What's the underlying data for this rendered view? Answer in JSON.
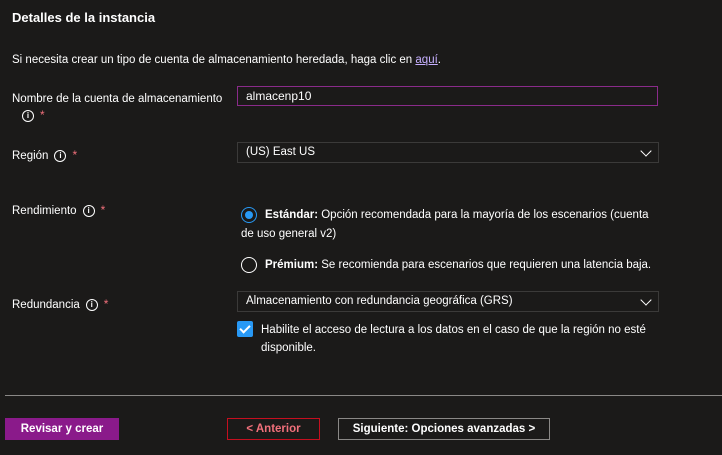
{
  "section": {
    "title": "Detalles de la instancia"
  },
  "intro": {
    "text": "Si necesita crear un tipo de cuenta de almacenamiento heredada, haga clic en ",
    "link": "aquí",
    "suffix": "."
  },
  "fields": {
    "account_name": {
      "label": "Nombre de la cuenta de almacenamiento",
      "value": "almacenp10",
      "required": "*"
    },
    "region": {
      "label": "Región",
      "value": "(US) East US",
      "required": "*"
    },
    "performance": {
      "label": "Rendimiento",
      "required": "*",
      "options": [
        {
          "title": "Estándar:",
          "description": " Opción recomendada para la mayoría de los escenarios (cuenta de uso general v2)",
          "selected": true
        },
        {
          "title": "Prémium:",
          "description": " Se recomienda para escenarios que requieren una latencia baja.",
          "selected": false
        }
      ]
    },
    "redundancy": {
      "label": "Redundancia",
      "value": "Almacenamiento con redundancia geográfica (GRS)",
      "required": "*",
      "read_access": {
        "label": "Habilite el acceso de lectura a los datos en el caso de que la región no esté disponible.",
        "checked": true
      }
    }
  },
  "info_icon": "info-icon",
  "footer": {
    "review_create": "Revisar y crear",
    "previous": "< Anterior",
    "next": "Siguiente: Opciones avanzadas >"
  },
  "colors": {
    "background": "#1b1a19",
    "accent_blue": "#2899f5",
    "primary_button": "#8a1a8a",
    "required": "#f1707b",
    "link": "#c6b0ff"
  }
}
